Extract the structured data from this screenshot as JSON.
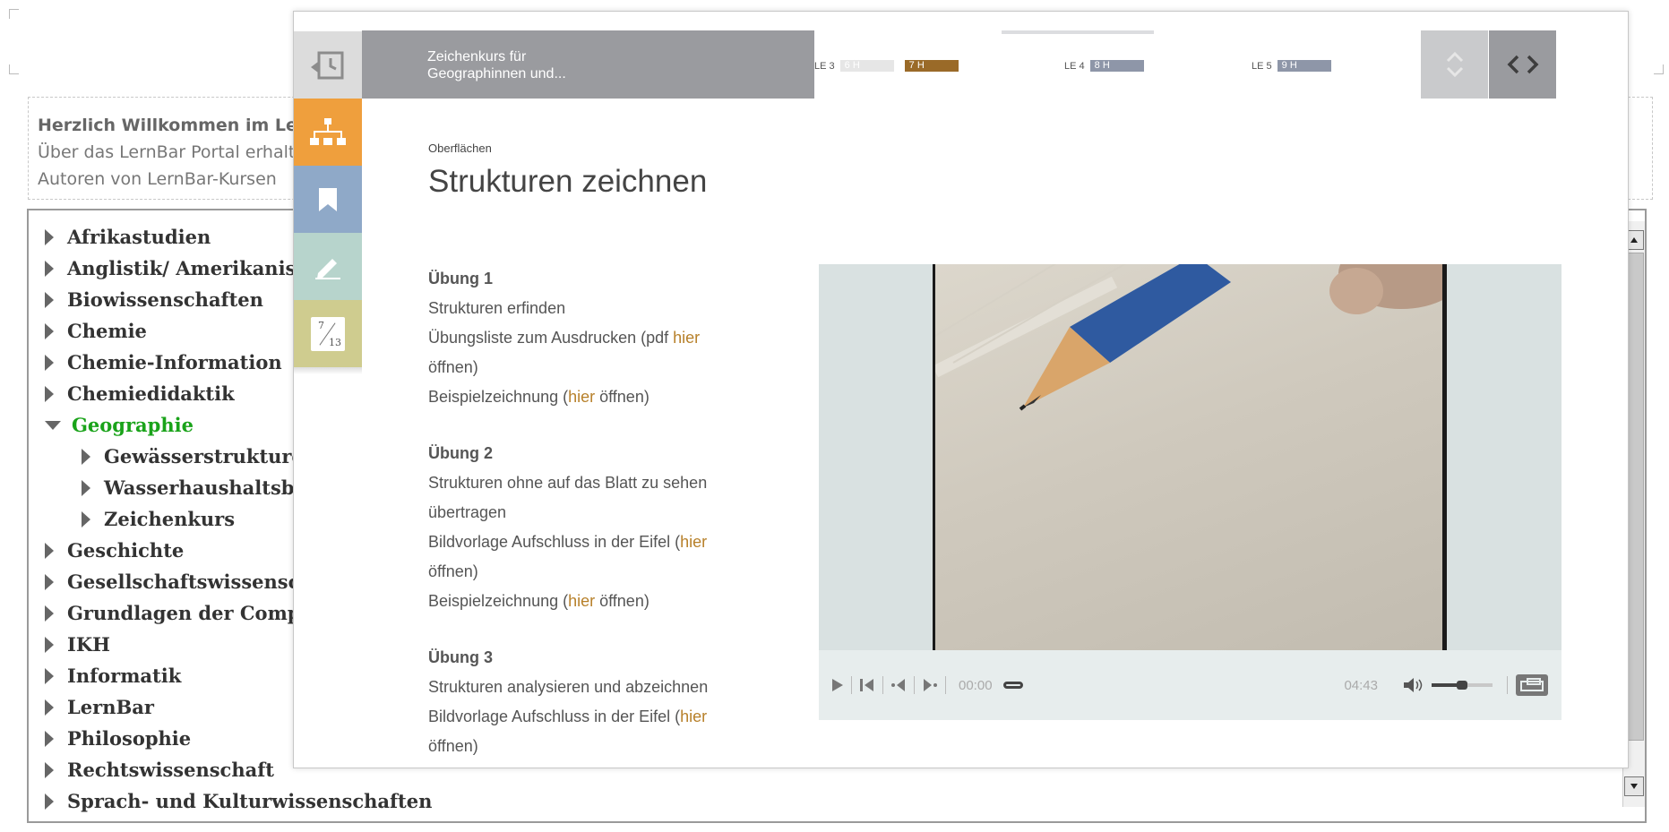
{
  "portal": {
    "welcome_line1": "Herzlich Willkommen im LernBar Portal",
    "welcome_line2": "Über das LernBar Portal erhalten Sie Zugriff auf die Kurse",
    "welcome_line3": "Autoren von LernBar-Kursen"
  },
  "tree": {
    "items": [
      {
        "label": "Afrikastudien"
      },
      {
        "label": "Anglistik/ Amerikanistik"
      },
      {
        "label": "Biowissenschaften"
      },
      {
        "label": "Chemie"
      },
      {
        "label": "Chemie-Information"
      },
      {
        "label": "Chemiedidaktik"
      },
      {
        "label": "Geographie"
      },
      {
        "label": "Gewässerstrukturgüte"
      },
      {
        "label": "Wasserhaushaltsbilanz"
      },
      {
        "label": "Zeichenkurs"
      },
      {
        "label": "Geschichte"
      },
      {
        "label": "Gesellschaftswissenschaften"
      },
      {
        "label": "Grundlagen der Computerlinguistik"
      },
      {
        "label": "IKH"
      },
      {
        "label": "Informatik"
      },
      {
        "label": "LernBar"
      },
      {
        "label": "Philosophie"
      },
      {
        "label": "Rechtswissenschaft"
      },
      {
        "label": "Sprach- und Kulturwissenschaften"
      }
    ]
  },
  "modal": {
    "course_title_line1": "Zeichenkurs für",
    "course_title_line2": "Geographinnen und...",
    "chapters": [
      {
        "label": "LE 3",
        "chips": [
          "6 H",
          "7 H"
        ]
      },
      {
        "label": "LE 4",
        "chips": [
          "8 H"
        ]
      },
      {
        "label": "LE 5",
        "chips": [
          "9 H"
        ]
      }
    ],
    "page_current": "7",
    "page_total": "13",
    "breadcrumb": "Oberflächen",
    "title": "Strukturen zeichnen",
    "exercises": [
      {
        "heading": "Übung 1",
        "lines": [
          {
            "pre": "Strukturen erfinden",
            "link": "",
            "post": ""
          },
          {
            "pre": "Übungsliste zum Ausdrucken (pdf ",
            "link": "hier",
            "post": " öffnen)"
          },
          {
            "pre": "Beispielzeichnung (",
            "link": "hier",
            "post": " öffnen)"
          }
        ]
      },
      {
        "heading": "Übung 2",
        "lines": [
          {
            "pre": "Strukturen ohne auf das Blatt zu sehen übertragen",
            "link": "",
            "post": ""
          },
          {
            "pre": "Bildvorlage Aufschluss in der Eifel (",
            "link": "hier",
            "post": " öffnen)"
          },
          {
            "pre": "Beispielzeichnung (",
            "link": "hier",
            "post": " öffnen)"
          }
        ]
      },
      {
        "heading": "Übung 3",
        "lines": [
          {
            "pre": "Strukturen analysieren und abzeichnen",
            "link": "",
            "post": ""
          },
          {
            "pre": "Bildvorlage Aufschluss in der Eifel (",
            "link": "hier",
            "post": " öffnen)"
          }
        ]
      }
    ],
    "video": {
      "current_time": "00:00",
      "duration": "04:43",
      "volume": 0.5,
      "progress": 0
    }
  },
  "colors": {
    "accent_orange": "#ef9f3d",
    "link_brown": "#b7802a",
    "tree_active_green": "#1aa31a",
    "chip_brown": "#9a6a28",
    "chip_gray": "#8e96a8"
  }
}
